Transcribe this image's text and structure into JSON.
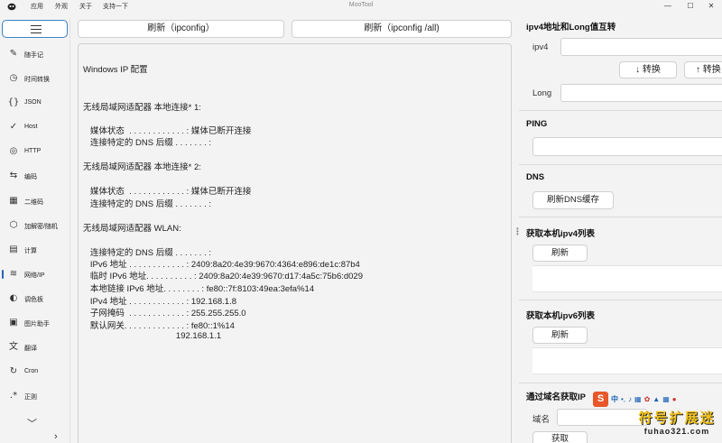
{
  "app": {
    "title": "MooTool",
    "menus": [
      "应用",
      "外观",
      "关于",
      "支持一下"
    ]
  },
  "sidebar": {
    "items": [
      {
        "icon": "notepad-icon",
        "glyph": "✎",
        "label": "随手记"
      },
      {
        "icon": "clock-icon",
        "glyph": "◷",
        "label": "时间转换"
      },
      {
        "icon": "json-icon",
        "glyph": "{}",
        "label": "JSON"
      },
      {
        "icon": "check-icon",
        "glyph": "✓",
        "label": "Host"
      },
      {
        "icon": "globe-icon",
        "glyph": "◎",
        "label": "HTTP"
      },
      {
        "icon": "swap-icon",
        "glyph": "⇆",
        "label": "编码"
      },
      {
        "icon": "qrcode-icon",
        "glyph": "▦",
        "label": "二维码"
      },
      {
        "icon": "cube-icon",
        "glyph": "⬡",
        "label": "加解密/随机"
      },
      {
        "icon": "calculator-icon",
        "glyph": "▤",
        "label": "计算"
      },
      {
        "icon": "wifi-icon",
        "glyph": "≋",
        "label": "网络/IP"
      },
      {
        "icon": "palette-icon",
        "glyph": "◐",
        "label": "调色板"
      },
      {
        "icon": "image-icon",
        "glyph": "▣",
        "label": "图片助手"
      },
      {
        "icon": "translate-icon",
        "glyph": "文",
        "label": "翻译"
      },
      {
        "icon": "cron-icon",
        "glyph": "↻",
        "label": "Cron"
      },
      {
        "icon": "regex-icon",
        "glyph": ".*",
        "label": "正则"
      }
    ],
    "active_index": 9
  },
  "toolbar": {
    "ipconfig_label": "刷新（ipconfig）",
    "ipconfig_all_label": "刷新（ipconfig /all)"
  },
  "output": {
    "lines": [
      "Windows IP 配置",
      "无线局域网适配器 本地连接* 1:",
      "   媒体状态  . . . . . . . . . . . . : 媒体已断开连接",
      "   连接特定的 DNS 后缀 . . . . . . . :",
      "无线局域网适配器 本地连接* 2:",
      "   媒体状态  . . . . . . . . . . . . : 媒体已断开连接",
      "   连接特定的 DNS 后缀 . . . . . . . :",
      "无线局域网适配器 WLAN:",
      "   连接特定的 DNS 后缀 . . . . . . . :",
      "   IPv6 地址 . . . . . . . . . . . . : 2409:8a20:4e39:9670:4364:e896:de1c:87b4",
      "   临时 IPv6 地址. . . . . . . . . . : 2409:8a20:4e39:9670:d17:4a5c:75b6:d029",
      "   本地链接 IPv6 地址. . . . . . . . : fe80::7f:8103:49ea:3efa%14",
      "   IPv4 地址 . . . . . . . . . . . . : 192.168.1.8",
      "   子网掩码  . . . . . . . . . . . . : 255.255.255.0",
      "   默认网关. . . . . . . . . . . . . : fe80::1%14",
      "                                       192.168.1.1"
    ]
  },
  "right": {
    "ipv4_long": {
      "title": "ipv4地址和Long值互转",
      "ipv4_label": "ipv4",
      "ipv4_value": "",
      "to_long_label": "↓ 转换",
      "to_ipv4_label": "↑ 转换",
      "long_label": "Long",
      "long_value": ""
    },
    "ping": {
      "title": "PING",
      "value": ""
    },
    "dns": {
      "title": "DNS",
      "flush_label": "刷新DNS缓存"
    },
    "ipv4_list": {
      "title": "获取本机ipv4列表",
      "refresh_label": "刷新"
    },
    "ipv6_list": {
      "title": "获取本机ipv6列表",
      "refresh_label": "刷新"
    },
    "domain_ip": {
      "title": "通过域名获取IP",
      "domain_label": "域名",
      "get_label": "获取"
    }
  },
  "ime": {
    "logo": "S",
    "mode": "中",
    "punct": "•,"
  },
  "watermark": {
    "line1": "符号扩展迷",
    "line2": "fuhao321.com"
  },
  "colors": {
    "accent": "#3b82c4",
    "active_bar": "#2563b8",
    "ime_orange": "#e8572a"
  }
}
